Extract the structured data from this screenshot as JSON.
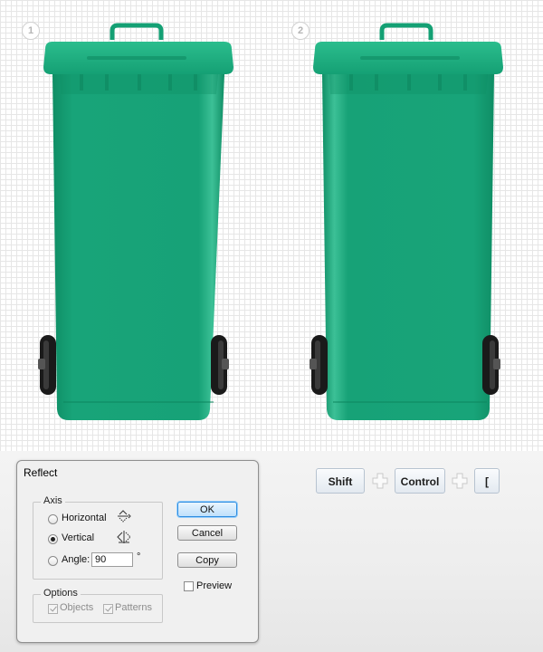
{
  "steps": [
    "1",
    "2"
  ],
  "colors": {
    "bin_green": "#17a477",
    "bin_green_dark": "#0f8a62",
    "wheel": "#1a1a1a",
    "grid_line": "#e6e6e6",
    "default_button_border": "#2d8ce0"
  },
  "dialog": {
    "title": "Reflect",
    "axis": {
      "label": "Axis",
      "horizontal_label": "Horizontal",
      "vertical_label": "Vertical",
      "angle_label": "Angle:",
      "angle_value": "90",
      "angle_unit": "°",
      "selected": "Vertical"
    },
    "options": {
      "label": "Options",
      "objects_label": "Objects",
      "patterns_label": "Patterns"
    },
    "buttons": {
      "ok": "OK",
      "cancel": "Cancel",
      "copy": "Copy"
    },
    "preview_label": "Preview"
  },
  "shortcut": {
    "keys": [
      "Shift",
      "Control",
      "["
    ]
  }
}
